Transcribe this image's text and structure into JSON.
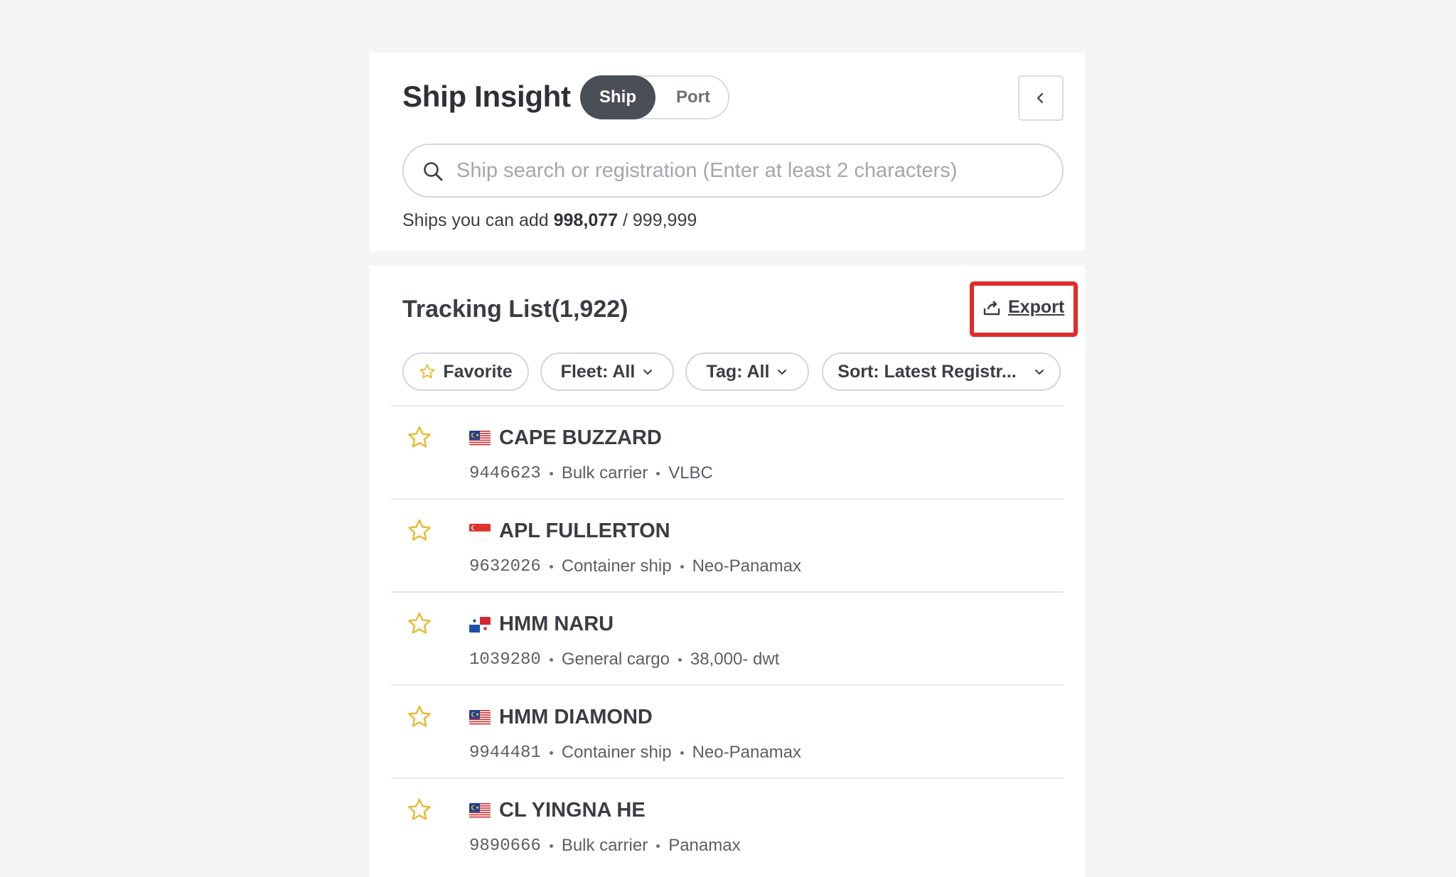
{
  "header": {
    "title": "Ship Insight",
    "toggle": {
      "ship_label": "Ship",
      "port_label": "Port",
      "selected": "Ship"
    },
    "collapse_icon": "chevron-left-icon"
  },
  "search": {
    "placeholder": "Ship search or registration (Enter at least 2 characters)",
    "value": ""
  },
  "quota": {
    "label": "Ships you can add",
    "available": "998,077",
    "separator": "/",
    "total": "999,999"
  },
  "tracking": {
    "title": "Tracking List(1,922)",
    "export_label": "Export",
    "filters": {
      "favorite": "Favorite",
      "fleet": "Fleet: All",
      "tag": "Tag: All",
      "sort": "Sort: Latest Registr..."
    }
  },
  "ships": [
    {
      "name": "CAPE BUZZARD",
      "imo": "9446623",
      "type": "Bulk carrier",
      "size": "VLBC",
      "flag": "MY"
    },
    {
      "name": "APL FULLERTON",
      "imo": "9632026",
      "type": "Container ship",
      "size": "Neo-Panamax",
      "flag": "SG"
    },
    {
      "name": "HMM NARU",
      "imo": "1039280",
      "type": "General cargo",
      "size": "38,000- dwt",
      "flag": "PA"
    },
    {
      "name": "HMM DIAMOND",
      "imo": "9944481",
      "type": "Container ship",
      "size": "Neo-Panamax",
      "flag": "MY"
    },
    {
      "name": "CL YINGNA HE",
      "imo": "9890666",
      "type": "Bulk carrier",
      "size": "Panamax",
      "flag": "MY"
    }
  ],
  "colors": {
    "accent_dark": "#4a4f57",
    "star": "#e8b931",
    "highlight_border": "#e02b2b",
    "text": "#3a3e44"
  }
}
